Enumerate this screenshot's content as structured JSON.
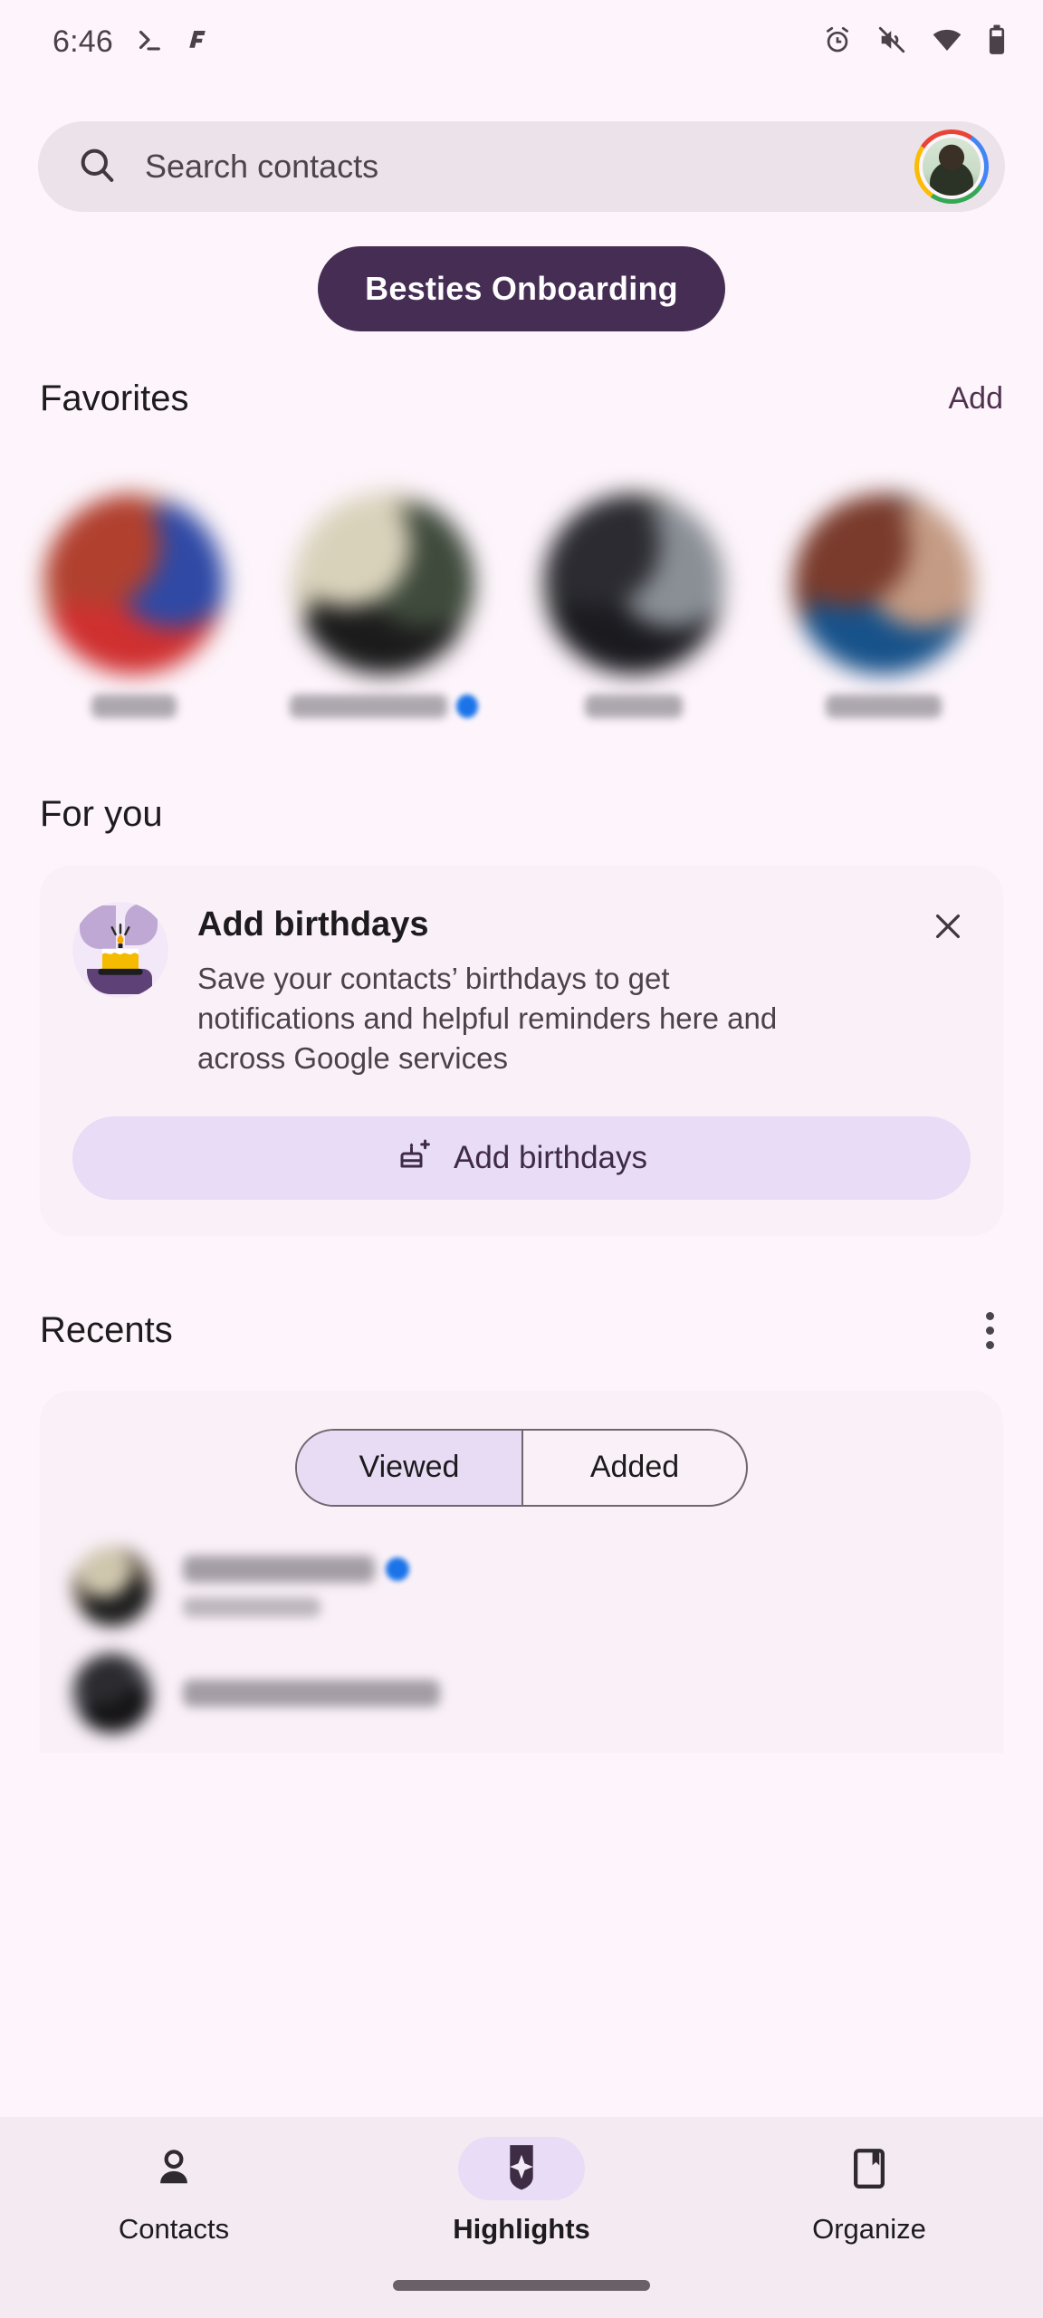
{
  "status_bar": {
    "time": "6:46",
    "left_icons": [
      "terminal-icon",
      "app-glyph-icon"
    ],
    "right_icons": [
      "alarm-icon",
      "mute-icon",
      "wifi-icon",
      "battery-icon"
    ]
  },
  "search": {
    "placeholder": "Search contacts",
    "icon": "search-icon",
    "avatar": "account-avatar"
  },
  "onboarding_chip": {
    "label": "Besties Onboarding"
  },
  "favorites": {
    "title": "Favorites",
    "action": "Add",
    "items": [
      {
        "name_redacted": true,
        "name_width": 94,
        "badge": false,
        "colors": [
          "#b1402f",
          "#2f49a5",
          "#cf3030",
          "#d7b489"
        ]
      },
      {
        "name_redacted": true,
        "name_width": 186,
        "badge": true,
        "colors": [
          "#d9d2bb",
          "#3f4a3c",
          "#1b1b1b",
          "#8d8060"
        ]
      },
      {
        "name_redacted": true,
        "name_width": 108,
        "badge": false,
        "colors": [
          "#2b2b31",
          "#8a8f96",
          "#1a1a1f",
          "#5d6a4a"
        ]
      },
      {
        "name_redacted": true,
        "name_width": 128,
        "badge": false,
        "colors": [
          "#7a3b2c",
          "#c49b84",
          "#17528a",
          "#2b1f1c"
        ]
      }
    ]
  },
  "for_you": {
    "title": "For you",
    "card": {
      "title": "Add birthdays",
      "description": "Save your contacts’ birthdays to get notifications and helpful reminders here and across Google services",
      "button_label": "Add birthdays",
      "button_icon": "cake-add-icon",
      "close_icon": "close-icon",
      "illustration": "birthday-cake-illustration"
    }
  },
  "recents": {
    "title": "Recents",
    "overflow_icon": "more-vert-icon",
    "tabs": [
      {
        "label": "Viewed",
        "selected": true
      },
      {
        "label": "Added",
        "selected": false
      }
    ],
    "items": [
      {
        "name_redacted": true,
        "name_width": 212,
        "badge": true,
        "sub_width": 152,
        "colors": [
          "#cfc6ae",
          "#4a4238",
          "#1d1d1d",
          "#7f7263"
        ]
      },
      {
        "name_redacted": true,
        "name_width": 284,
        "badge": false,
        "sub_width": 0,
        "colors": [
          "#2c2c30",
          "#55555c",
          "#141417",
          "#3a3a40"
        ]
      }
    ]
  },
  "bottom_nav": {
    "items": [
      {
        "label": "Contacts",
        "icon": "person-icon",
        "selected": false
      },
      {
        "label": "Highlights",
        "icon": "sparkle-icon",
        "selected": true
      },
      {
        "label": "Organize",
        "icon": "bookmark-icon",
        "selected": false
      }
    ]
  },
  "colors": {
    "page_background": "#fdf5fb",
    "search_field": "#ece2ea",
    "chip_background": "#452d54",
    "chip_text": "#ffffff",
    "accent_purple": "#50314f",
    "card_background": "#faf1f8",
    "button_fill": "#e8dcf6",
    "nav_background": "#f3eaf2",
    "nav_pill": "#e9dcf7",
    "badge_blue": "#1a73e8",
    "text_primary": "#1d1b1e"
  }
}
